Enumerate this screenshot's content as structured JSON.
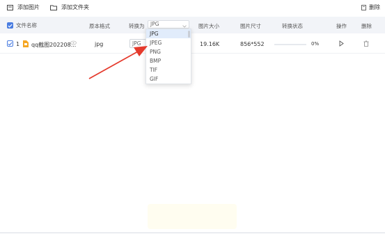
{
  "toolbar": {
    "add_image_label": "添加图片",
    "add_folder_label": "添加文件夹",
    "delete_label": "删除"
  },
  "header": {
    "filename": "文件名称",
    "orig_format": "原本格式",
    "convert_to": "转换为",
    "size": "图片大小",
    "dimensions": "图片尺寸",
    "status": "转换状态",
    "action": "操作",
    "delete": "删除"
  },
  "convert_select": {
    "value": "JPG",
    "options": [
      "JPG",
      "JPEG",
      "PNG",
      "BMP",
      "TIF",
      "GIF"
    ],
    "selected_index": 0
  },
  "rows": [
    {
      "index": "1",
      "filename": "qq截图202208...",
      "orig_format": "jpg",
      "target_format": "JPG",
      "size": "19.16K",
      "dimensions": "856*552",
      "progress_text": "0%",
      "progress": 0
    }
  ],
  "colors": {
    "accent": "#4a7de1",
    "header_bg": "#f2f4f8",
    "arrow": "#e53a2c",
    "file_icon": "#f5a623"
  },
  "icons": {
    "add_image": "image-icon",
    "add_folder": "folder-icon",
    "delete": "trash-icon",
    "play": "play-icon",
    "preview": "eye-icon"
  }
}
